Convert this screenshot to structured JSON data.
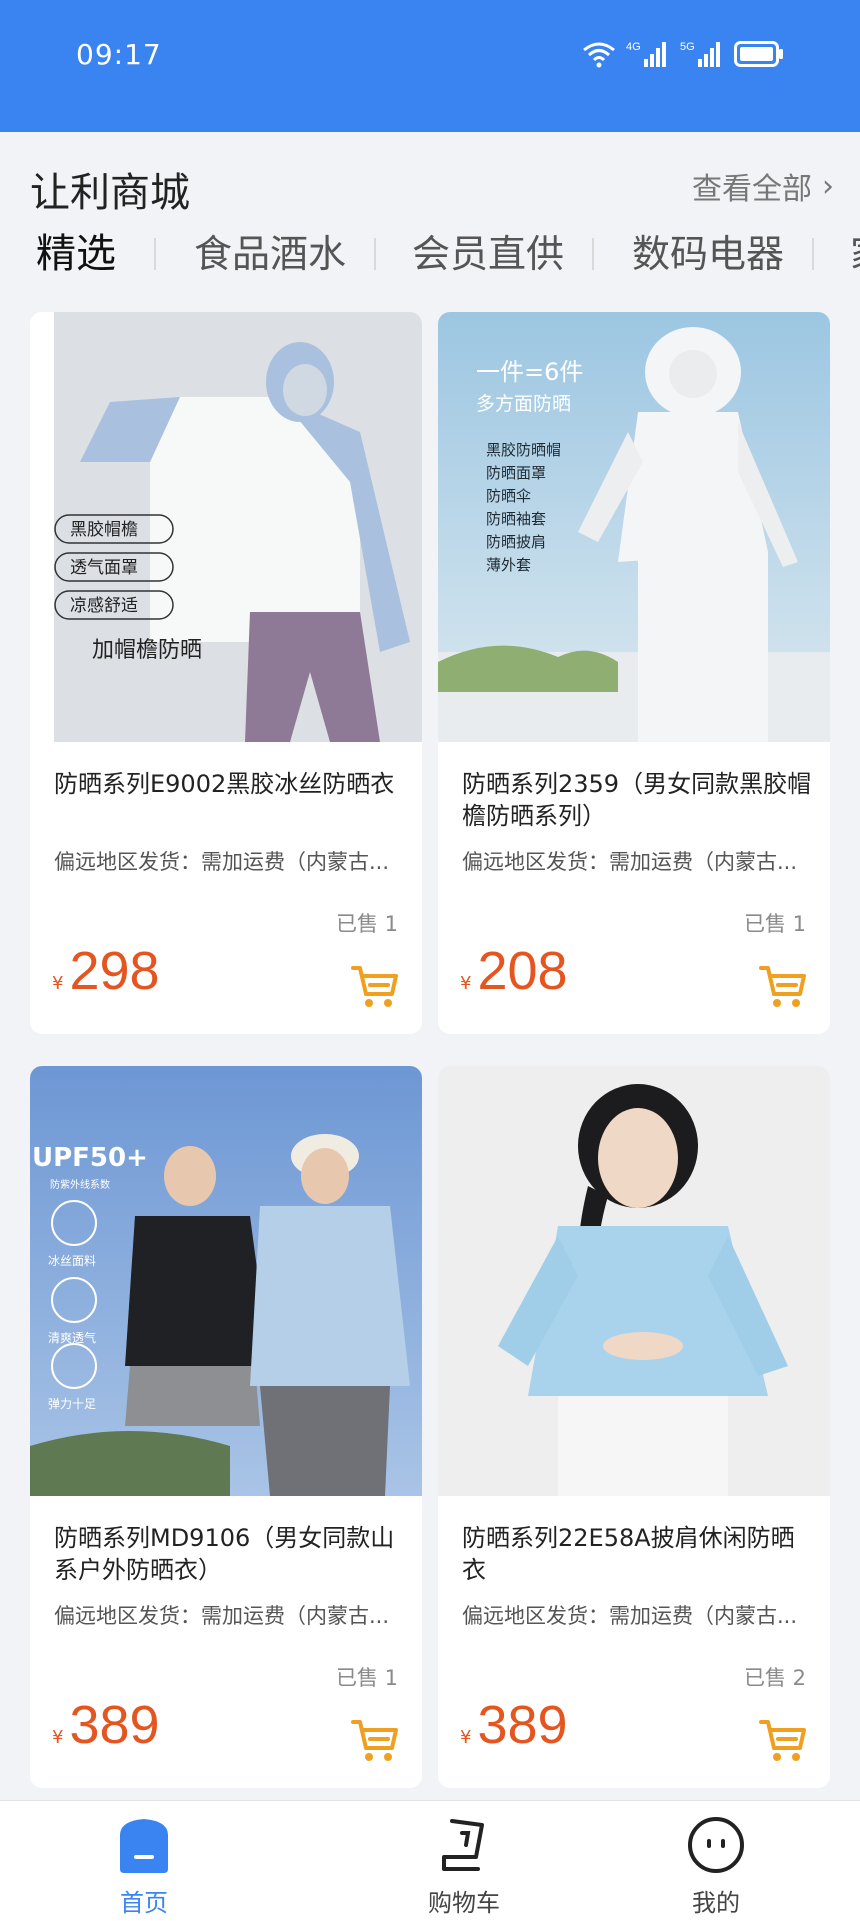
{
  "status_bar": {
    "time": "09:17",
    "net_a": "4G",
    "net_b": "5G"
  },
  "header": {
    "title": "让利商城",
    "see_all": "查看全部"
  },
  "tabs": [
    {
      "label": "精选"
    },
    {
      "label": "食品酒水"
    },
    {
      "label": "会员直供"
    },
    {
      "label": "数码电器"
    },
    {
      "label": "家"
    }
  ],
  "products": [
    {
      "title": "防晒系列E9002黑胶冰丝防晒衣",
      "shipping": "偏远地区发货：需加运费（内蒙古...",
      "sold": "已售 1",
      "currency": "¥",
      "price": "298",
      "image_tags": [
        "黑胶帽檐",
        "透气面罩",
        "凉感舒适"
      ],
      "image_caption": "加帽檐防晒"
    },
    {
      "title": "防晒系列2359（男女同款黑胶帽檐防晒系列）",
      "shipping": "偏远地区发货：需加运费（内蒙古...",
      "sold": "已售 1",
      "currency": "¥",
      "price": "208",
      "image_headline": "一件=6件",
      "image_subhead": "多方面防晒",
      "image_list": [
        "黑胶防晒帽",
        "防晒面罩",
        "防晒伞",
        "防晒袖套",
        "防晒披肩",
        "薄外套"
      ]
    },
    {
      "title": "防晒系列MD9106（男女同款山系户外防晒衣）",
      "shipping": "偏远地区发货：需加运费（内蒙古...",
      "sold": "已售 1",
      "currency": "¥",
      "price": "389",
      "image_headline": "UPF50+",
      "image_subhead": "防紫外线系数",
      "image_features": [
        "冰丝面料",
        "清爽透气",
        "弹力十足"
      ]
    },
    {
      "title": "防晒系列22E58A披肩休闲防晒衣",
      "shipping": "偏远地区发货：需加运费（内蒙古...",
      "sold": "已售 2",
      "currency": "¥",
      "price": "389"
    }
  ],
  "bottom_nav": [
    {
      "label": "首页",
      "icon": "home-icon",
      "active": true
    },
    {
      "label": "购物车",
      "icon": "cart-icon",
      "active": false
    },
    {
      "label": "我的",
      "icon": "profile-icon",
      "active": false
    }
  ],
  "colors": {
    "accent": "#3a84f2",
    "price": "#e5551f",
    "cart": "#f0a020"
  }
}
